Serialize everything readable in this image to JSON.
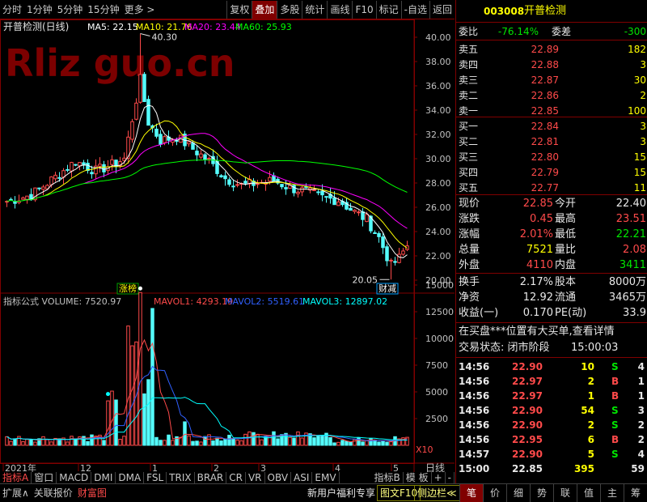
{
  "toolbar": {
    "left_tabs": [
      "分时",
      "1分钟",
      "5分钟",
      "15分钟",
      "更多 >"
    ],
    "right_tabs": [
      "复权",
      "叠加",
      "多股",
      "统计",
      "画线",
      "F10",
      "标记",
      "-自选",
      "返回"
    ],
    "active_right": "叠加"
  },
  "main_chart": {
    "title": "开普检测(日线)",
    "ma": [
      {
        "label": "MA5: 22.15",
        "color": "#ffffff"
      },
      {
        "label": "MA10: 21.76",
        "color": "#ffff00"
      },
      {
        "label": "MA20: 23.44",
        "color": "#ff00ff"
      },
      {
        "label": "MA60: 25.93",
        "color": "#00ff00"
      }
    ],
    "price_axis": [
      "40.00",
      "38.00",
      "36.00",
      "34.00",
      "32.00",
      "30.00",
      "28.00",
      "26.00",
      "24.00",
      "22.00",
      "20.00"
    ],
    "high_label": "40.30",
    "low_label": "20.05",
    "tag_left": "涨榜",
    "tag_right": "财减",
    "watermark": "Rliz  guo.cn"
  },
  "volume_chart": {
    "title": "指标公式 VOLUME: 7520.97",
    "indicators": [
      {
        "label": "MAVOL1: 4293.19",
        "color": "#ff4a4a"
      },
      {
        "label": "MAVOL2: 5519.61",
        "color": "#3060ff"
      },
      {
        "label": "MAVOL3: 12897.02",
        "color": "#00ffff"
      }
    ],
    "axis": [
      "15000",
      "12500",
      "10000",
      "7500",
      "5000",
      "2500"
    ],
    "unit": "X10"
  },
  "time_axis": {
    "labels": [
      "2021年",
      "12",
      "1",
      "2",
      "3",
      "4",
      "5"
    ],
    "period": "日线"
  },
  "indicator_tabs": [
    "指标A",
    "窗口",
    "MACD",
    "DMI",
    "DMA",
    "FSL",
    "TRIX",
    "BRAR",
    "CR",
    "VR",
    "OBV",
    "ASI",
    "EMV",
    "指标B",
    "模 板",
    "+",
    "-"
  ],
  "stock": {
    "code": "003008",
    "name": "开普检测",
    "weibi_label": "委比",
    "weibi": "-76.14%",
    "weicha_label": "委差",
    "weicha": "-300",
    "asks": [
      {
        "label": "卖五",
        "price": "22.89",
        "vol": "182"
      },
      {
        "label": "卖四",
        "price": "22.88",
        "vol": "3"
      },
      {
        "label": "卖三",
        "price": "22.87",
        "vol": "30"
      },
      {
        "label": "卖二",
        "price": "22.86",
        "vol": "2"
      },
      {
        "label": "卖一",
        "price": "22.85",
        "vol": "100"
      }
    ],
    "bids": [
      {
        "label": "买一",
        "price": "22.84",
        "vol": "3"
      },
      {
        "label": "买二",
        "price": "22.81",
        "vol": "3"
      },
      {
        "label": "买三",
        "price": "22.80",
        "vol": "15"
      },
      {
        "label": "买四",
        "price": "22.79",
        "vol": "15"
      },
      {
        "label": "买五",
        "price": "22.77",
        "vol": "11"
      }
    ],
    "quote": [
      {
        "l1": "现价",
        "v1": "22.85",
        "c1": "red",
        "l2": "今开",
        "v2": "22.40",
        "c2": "wht"
      },
      {
        "l1": "涨跌",
        "v1": "0.45",
        "c1": "red",
        "l2": "最高",
        "v2": "23.51",
        "c2": "red"
      },
      {
        "l1": "涨幅",
        "v1": "2.01%",
        "c1": "red",
        "l2": "最低",
        "v2": "22.21",
        "c2": "grn"
      },
      {
        "l1": "总量",
        "v1": "7521",
        "c1": "yel",
        "l2": "量比",
        "v2": "2.08",
        "c2": "red"
      },
      {
        "l1": "外盘",
        "v1": "4110",
        "c1": "red",
        "l2": "内盘",
        "v2": "3411",
        "c2": "grn"
      }
    ],
    "fund": [
      {
        "l1": "换手",
        "v1": "2.17%",
        "l2": "股本",
        "v2": "8000万"
      },
      {
        "l1": "净资",
        "v1": "12.92",
        "l2": "流通",
        "v2": "3465万"
      },
      {
        "l1": "收益(一)",
        "v1": "0.170",
        "l2": "PE(动)",
        "v2": "33.9"
      }
    ],
    "notice": "在买盘***位置有大买单,查看详情",
    "status_label": "交易状态: 闭市阶段",
    "status_time": "15:00:03",
    "ticks": [
      {
        "time": "14:56",
        "price": "22.90",
        "vol": "10",
        "side": "S",
        "n": "4"
      },
      {
        "time": "14:56",
        "price": "22.97",
        "vol": "2",
        "side": "B",
        "n": "1"
      },
      {
        "time": "14:56",
        "price": "22.97",
        "vol": "1",
        "side": "B",
        "n": "1"
      },
      {
        "time": "14:56",
        "price": "22.90",
        "vol": "54",
        "side": "S",
        "n": "3"
      },
      {
        "time": "14:56",
        "price": "22.90",
        "vol": "2",
        "side": "S",
        "n": "2"
      },
      {
        "time": "14:56",
        "price": "22.95",
        "vol": "6",
        "side": "B",
        "n": "2"
      },
      {
        "time": "14:57",
        "price": "22.90",
        "vol": "5",
        "side": "S",
        "n": "4"
      },
      {
        "time": "15:00",
        "price": "22.85",
        "vol": "395",
        "side": "",
        "n": "59"
      }
    ]
  },
  "bottom": {
    "left": [
      "扩展∧",
      "关联报价",
      "财富图"
    ],
    "active": "财富图",
    "promo": "新用户福利专享",
    "mid": [
      "图文F10",
      "侧边栏≪"
    ],
    "right_tabs": [
      "笔",
      "价",
      "细",
      "势",
      "联",
      "值",
      "主",
      "筹"
    ],
    "active_right": "笔"
  }
}
